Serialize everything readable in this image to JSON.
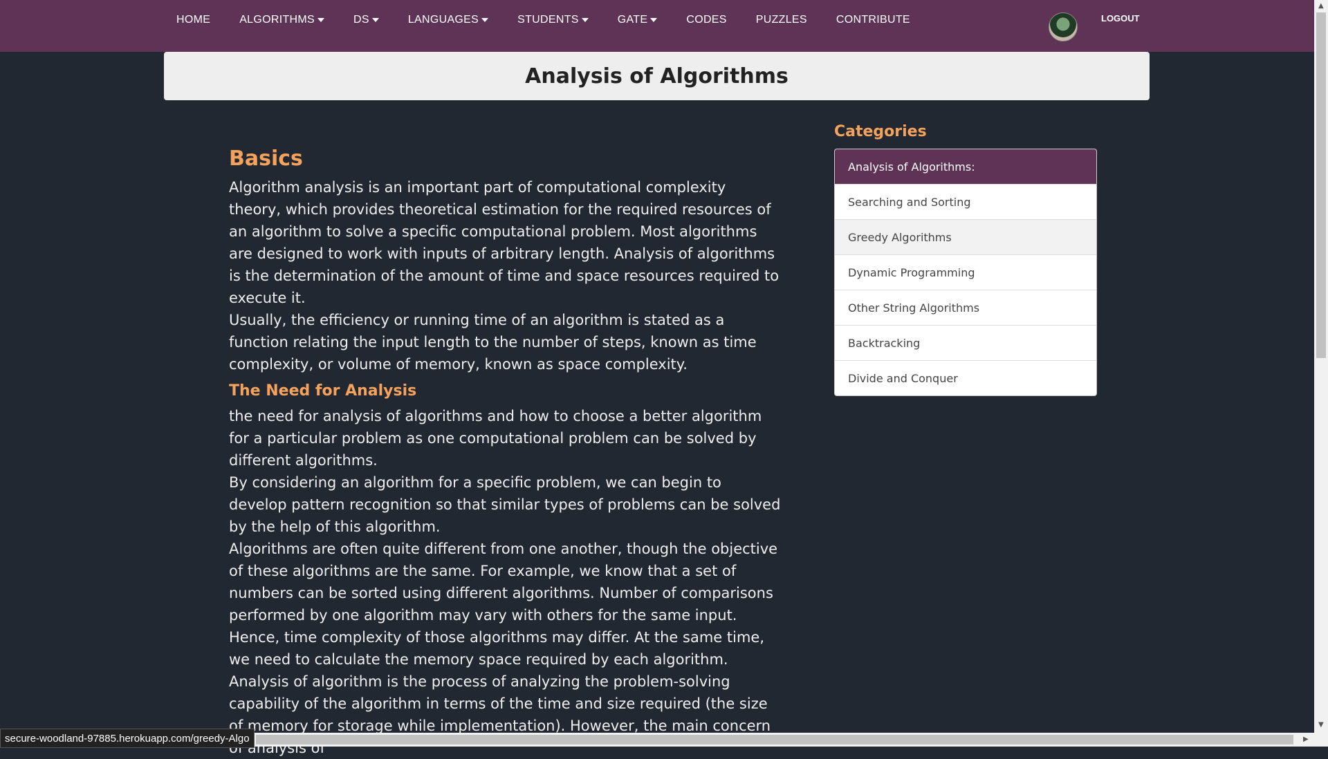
{
  "nav": {
    "items": [
      {
        "label": "HOME",
        "dropdown": false
      },
      {
        "label": "ALGORITHMS",
        "dropdown": true
      },
      {
        "label": "DS",
        "dropdown": true
      },
      {
        "label": "LANGUAGES",
        "dropdown": true
      },
      {
        "label": "STUDENTS",
        "dropdown": true
      },
      {
        "label": "GATE",
        "dropdown": true
      },
      {
        "label": "CODES",
        "dropdown": false
      },
      {
        "label": "PUZZLES",
        "dropdown": false
      },
      {
        "label": "CONTRIBUTE",
        "dropdown": false
      }
    ],
    "logout": "LOGOUT"
  },
  "page_title": "Analysis of Algorithms",
  "content": {
    "basics_heading": "Basics",
    "basics_p1": "Algorithm analysis is an important part of computational complexity theory, which provides theoretical estimation for the required resources of an algorithm to solve a specific computational problem. Most algorithms are designed to work with inputs of arbitrary length. Analysis of algorithms is the determination of the amount of time and space resources required to execute it.",
    "basics_p2": "Usually, the efficiency or running time of an algorithm is stated as a function relating the input length to the number of steps, known as time complexity, or volume of memory, known as space complexity.",
    "need_heading": "The Need for Analysis",
    "need_p1": "the need for analysis of algorithms and how to choose a better algorithm for a particular problem as one computational problem can be solved by different algorithms.",
    "need_p2": "By considering an algorithm for a specific problem, we can begin to develop pattern recognition so that similar types of problems can be solved by the help of this algorithm.",
    "need_p3": "Algorithms are often quite different from one another, though the objective of these algorithms are the same. For example, we know that a set of numbers can be sorted using different algorithms. Number of comparisons performed by one algorithm may vary with others for the same input. Hence, time complexity of those algorithms may differ. At the same time, we need to calculate the memory space required by each algorithm.",
    "need_p4": "Analysis of algorithm is the process of analyzing the problem-solving capability of the algorithm in terms of the time and size required (the size of memory for storage while implementation). However, the main concern of analysis of"
  },
  "sidebar": {
    "title": "Categories",
    "items": [
      "Analysis of Algorithms:",
      "Searching and Sorting",
      "Greedy Algorithms",
      "Dynamic Programming",
      "Other String Algorithms",
      "Backtracking",
      "Divide and Conquer"
    ]
  },
  "status_url": "secure-woodland-97885.herokuapp.com/greedy-Algo",
  "colors": {
    "nav_bg": "#5e3356",
    "page_bg": "#222831",
    "accent": "#f5a25d",
    "active_item_bg": "#5e3356"
  }
}
